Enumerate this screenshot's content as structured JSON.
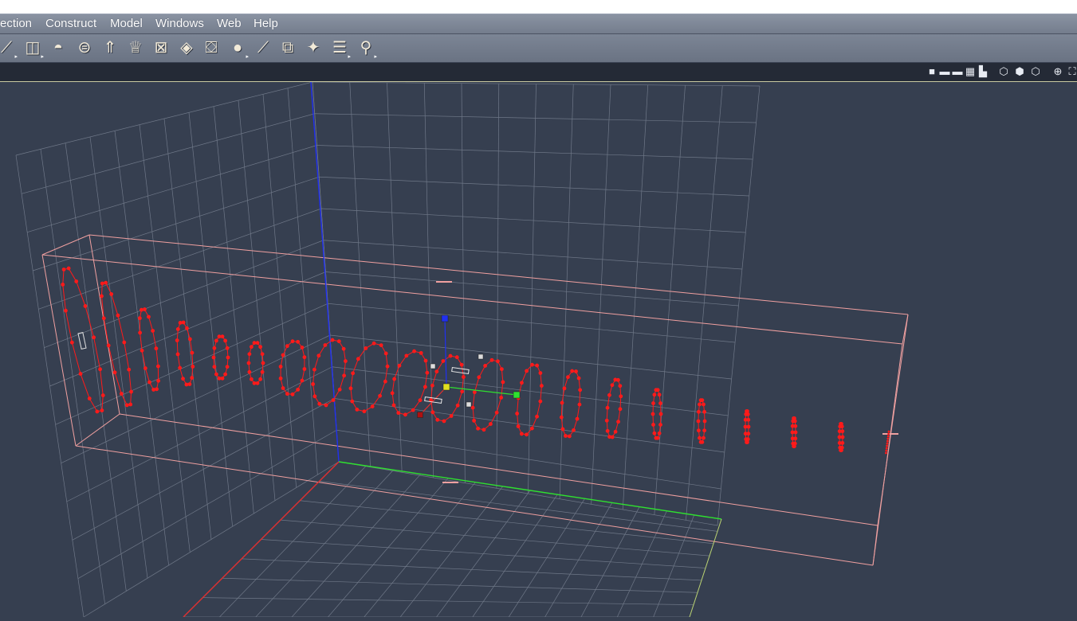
{
  "menu": {
    "items": [
      "ection",
      "Construct",
      "Model",
      "Windows",
      "Web",
      "Help"
    ]
  },
  "toolbar": {
    "tools": [
      {
        "name": "select-tool-icon",
        "glyph": "⟋",
        "flyout": true
      },
      {
        "name": "face-tool-icon",
        "glyph": "◫",
        "flyout": true
      },
      {
        "name": "dome-icon",
        "glyph": "◓",
        "flyout": false
      },
      {
        "name": "lathe-icon",
        "glyph": "⊜",
        "flyout": false
      },
      {
        "name": "extrude-icon",
        "glyph": "⇑",
        "flyout": false
      },
      {
        "name": "goblet-icon",
        "glyph": "♕",
        "flyout": false
      },
      {
        "name": "boolean-icon",
        "glyph": "⊠",
        "flyout": false
      },
      {
        "name": "box-icon",
        "glyph": "◈",
        "flyout": false
      },
      {
        "name": "bag-icon",
        "glyph": "⛋",
        "flyout": false
      },
      {
        "name": "sphere-icon",
        "glyph": "●",
        "flyout": true
      },
      {
        "name": "line-icon",
        "glyph": "⟋",
        "flyout": false
      },
      {
        "name": "deform-icon",
        "glyph": "⧉",
        "flyout": false
      },
      {
        "name": "morph-icon",
        "glyph": "✦",
        "flyout": false
      },
      {
        "name": "align-icon",
        "glyph": "☰",
        "flyout": true
      },
      {
        "name": "skin-icon",
        "glyph": "⚲",
        "flyout": true
      }
    ]
  },
  "viewbar": {
    "label": "",
    "layout_icons": [
      "single-view-icon",
      "two-view-icon",
      "three-view-icon",
      "four-view-icon",
      "split-view-icon"
    ],
    "shading_icons": [
      "wireframe-icon",
      "shaded-icon",
      "render-icon"
    ],
    "nav_icons": [
      "navigate-icon",
      "fit-view-icon"
    ]
  },
  "colors": {
    "background": "#363f50",
    "grid": "#6f7888",
    "axis_x": "#e03030",
    "axis_y": "#2fe02f",
    "axis_z": "#2030f0",
    "selection_box": "#f0a0a0",
    "points": "#ff1a1a",
    "gizmo_center": "#e0e020"
  }
}
